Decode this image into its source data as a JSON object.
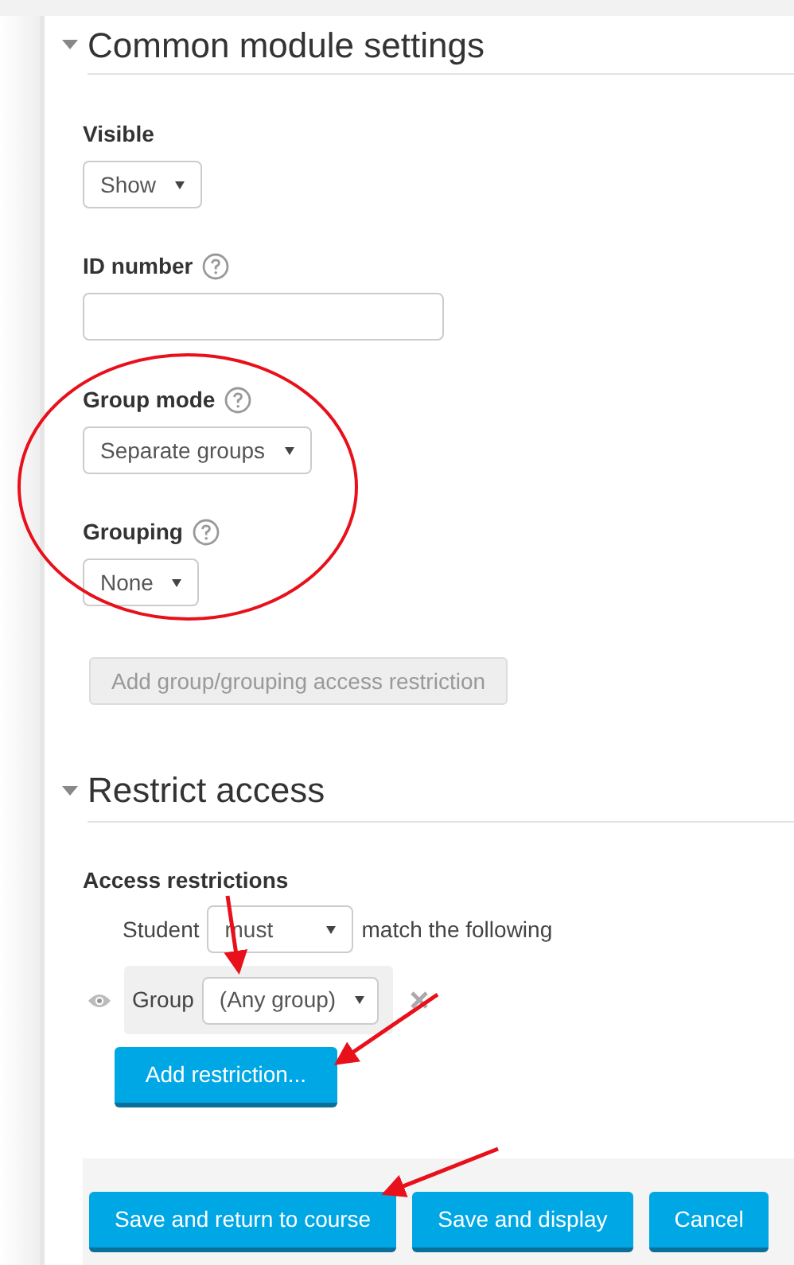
{
  "common_settings": {
    "title": "Common module settings",
    "expanded": true,
    "fields": [
      {
        "kind": "select",
        "label": "Visible",
        "help": false,
        "value": "Show"
      },
      {
        "kind": "text",
        "label": "ID number",
        "help": true
      },
      {
        "kind": "select",
        "label": "Group mode",
        "help": true,
        "value": "Separate groups"
      },
      {
        "kind": "select",
        "label": "Grouping",
        "help": true,
        "value": "None"
      }
    ],
    "restriction_button": {
      "label": "Add group/grouping access restriction",
      "disabled": true
    }
  },
  "restrict_access": {
    "title": "Restrict access",
    "expanded": true,
    "label": "Access restrictions",
    "prefix": "Student",
    "match": "must",
    "suffix": "match the following",
    "condition": {
      "label": "Group",
      "value": "(Any group)"
    },
    "add_button": "Add restriction..."
  },
  "buttons": [
    "Save and return to course",
    "Save and display",
    "Cancel"
  ]
}
